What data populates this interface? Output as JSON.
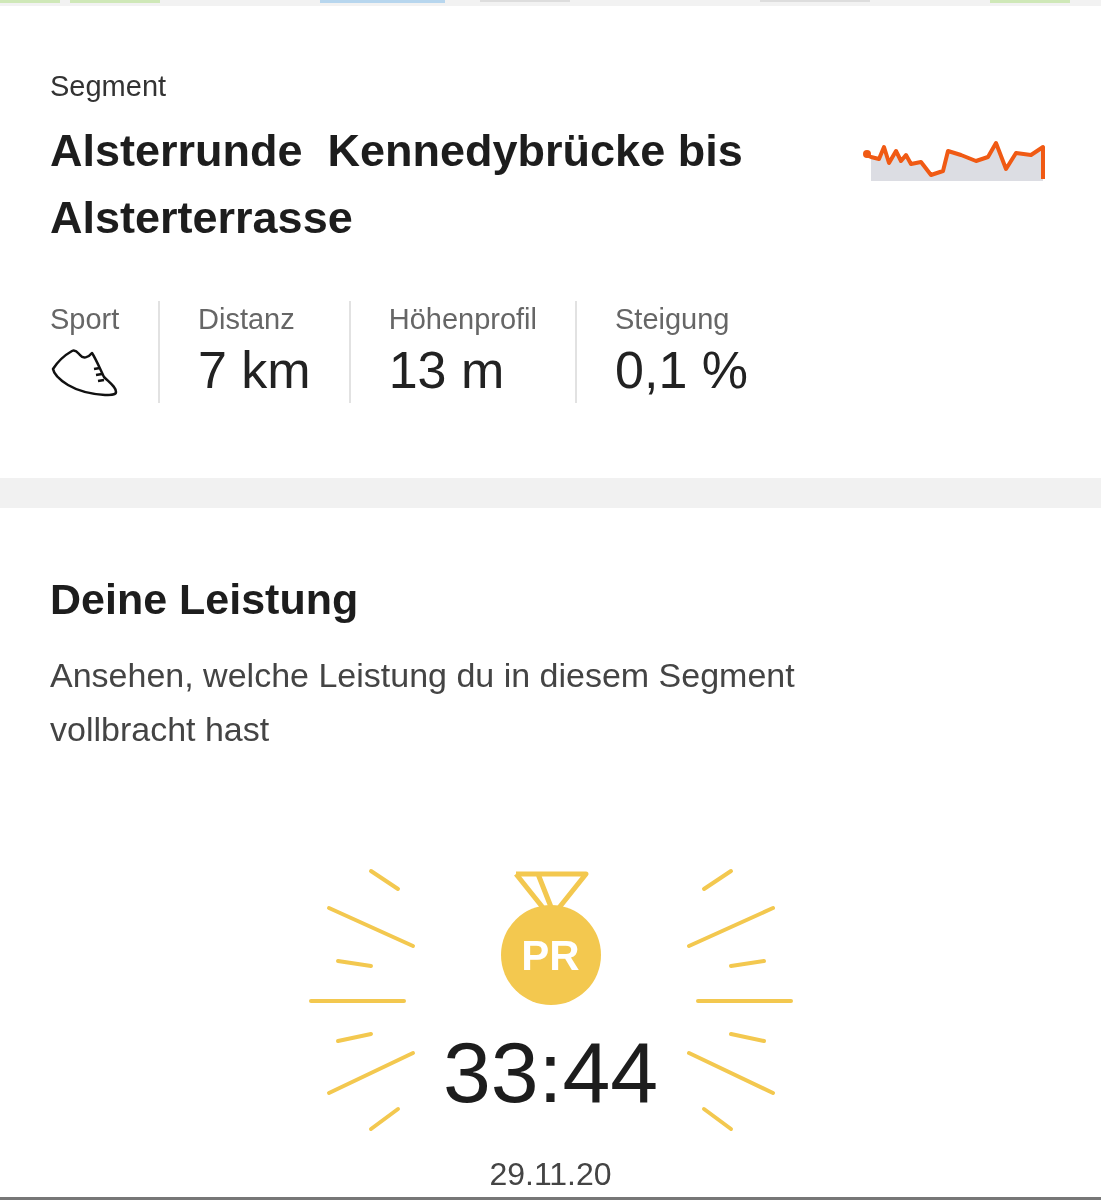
{
  "segment": {
    "label": "Segment",
    "title": "Alsterrunde  Kennedybrücke bis Alsterterrasse",
    "stats": [
      {
        "kind": "icon",
        "label": "Sport"
      },
      {
        "kind": "text",
        "label": "Distanz",
        "value": "7 km"
      },
      {
        "kind": "text",
        "label": "Höhenprofil",
        "value": "13 m"
      },
      {
        "kind": "text",
        "label": "Steigung",
        "value": "0,1 %"
      }
    ]
  },
  "performance": {
    "title": "Deine Leistung",
    "description": "Ansehen, welche Leistung du in diesem Segment vollbracht hast",
    "badge": "PR",
    "time": "33:44",
    "date": "29.11.20"
  }
}
